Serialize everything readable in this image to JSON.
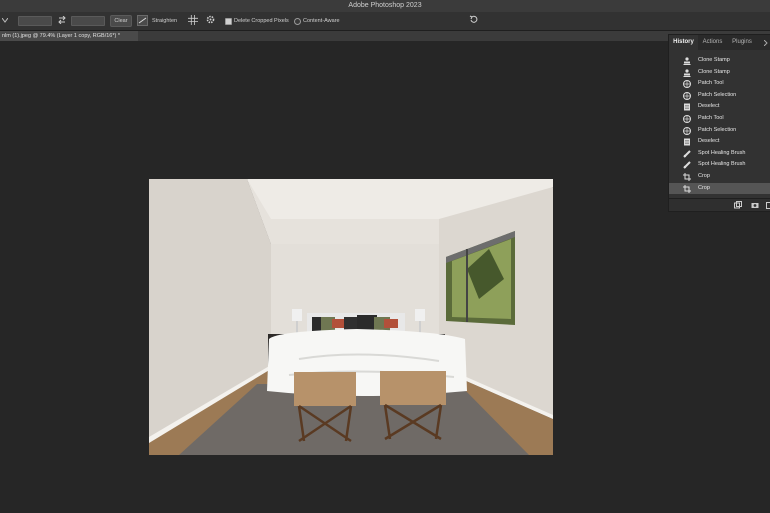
{
  "app": {
    "title": "Adobe Photoshop 2023"
  },
  "options_bar": {
    "clear_label": "Clear",
    "straighten_label": "Straighten",
    "delete_cropped_label": "Delete Cropped Pixels",
    "content_aware_label": "Content-Aware",
    "delete_cropped_checked": true,
    "content_aware_checked": false
  },
  "document": {
    "tab_title": "nlm (1).jpeg @ 79.4% (Layer 1 copy, RGB/16*) *"
  },
  "panel": {
    "tabs": [
      {
        "label": "History"
      },
      {
        "label": "Actions"
      },
      {
        "label": "Plugins"
      }
    ],
    "active_tab": "History",
    "history": [
      {
        "label": "Clone Stamp",
        "icon": "clone-stamp-icon"
      },
      {
        "label": "Clone Stamp",
        "icon": "clone-stamp-icon"
      },
      {
        "label": "Patch Tool",
        "icon": "patch-tool-icon"
      },
      {
        "label": "Patch Selection",
        "icon": "patch-tool-icon"
      },
      {
        "label": "Deselect",
        "icon": "document-icon"
      },
      {
        "label": "Patch Tool",
        "icon": "patch-tool-icon"
      },
      {
        "label": "Patch Selection",
        "icon": "patch-tool-icon"
      },
      {
        "label": "Deselect",
        "icon": "document-icon"
      },
      {
        "label": "Spot Healing Brush",
        "icon": "healing-brush-icon"
      },
      {
        "label": "Spot Healing Brush",
        "icon": "healing-brush-icon"
      },
      {
        "label": "Crop",
        "icon": "crop-icon"
      },
      {
        "label": "Crop",
        "icon": "crop-icon"
      }
    ],
    "active_history_index": 11
  },
  "colors": {
    "workspace": "#262626",
    "panel_bg": "#323232",
    "active_row": "#555555"
  }
}
